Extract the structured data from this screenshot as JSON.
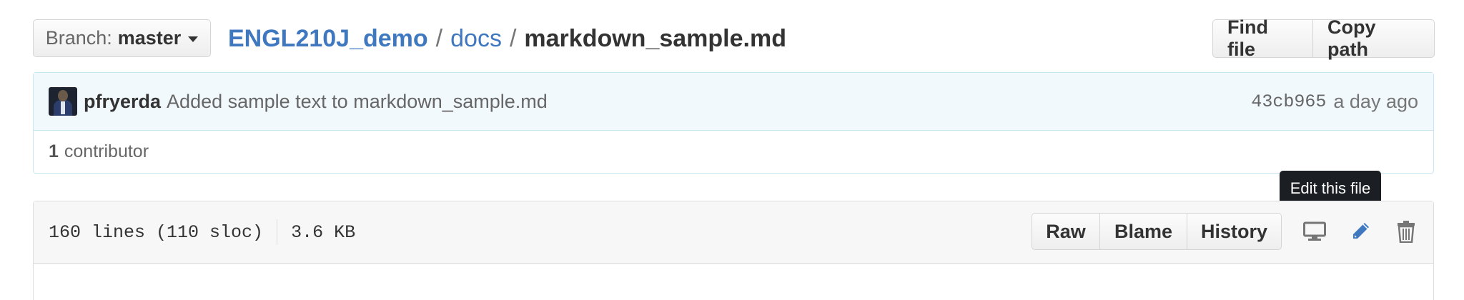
{
  "branch": {
    "prefix": "Branch:",
    "name": "master"
  },
  "breadcrumb": {
    "repo": "ENGL210J_demo",
    "sep1": "/",
    "dir": "docs",
    "sep2": "/",
    "file": "markdown_sample.md"
  },
  "top_actions": {
    "find_file": "Find file",
    "copy_path": "Copy path"
  },
  "commit": {
    "author": "pfryerda",
    "message": "Added sample text to markdown_sample.md",
    "sha": "43cb965",
    "time": "a day ago"
  },
  "contributors": {
    "count": "1",
    "label": "contributor"
  },
  "file": {
    "lines": "160 lines (110 sloc)",
    "size": "3.6 KB",
    "actions": {
      "raw": "Raw",
      "blame": "Blame",
      "history": "History"
    },
    "icons": [
      "desktop-icon",
      "pencil-icon",
      "trash-icon"
    ]
  },
  "tooltip": "Edit this file",
  "colors": {
    "link": "#4078c0",
    "pencil": "#4078c0",
    "commit_bg": "#f2f9fc",
    "commit_border": "#c9e6f2"
  }
}
